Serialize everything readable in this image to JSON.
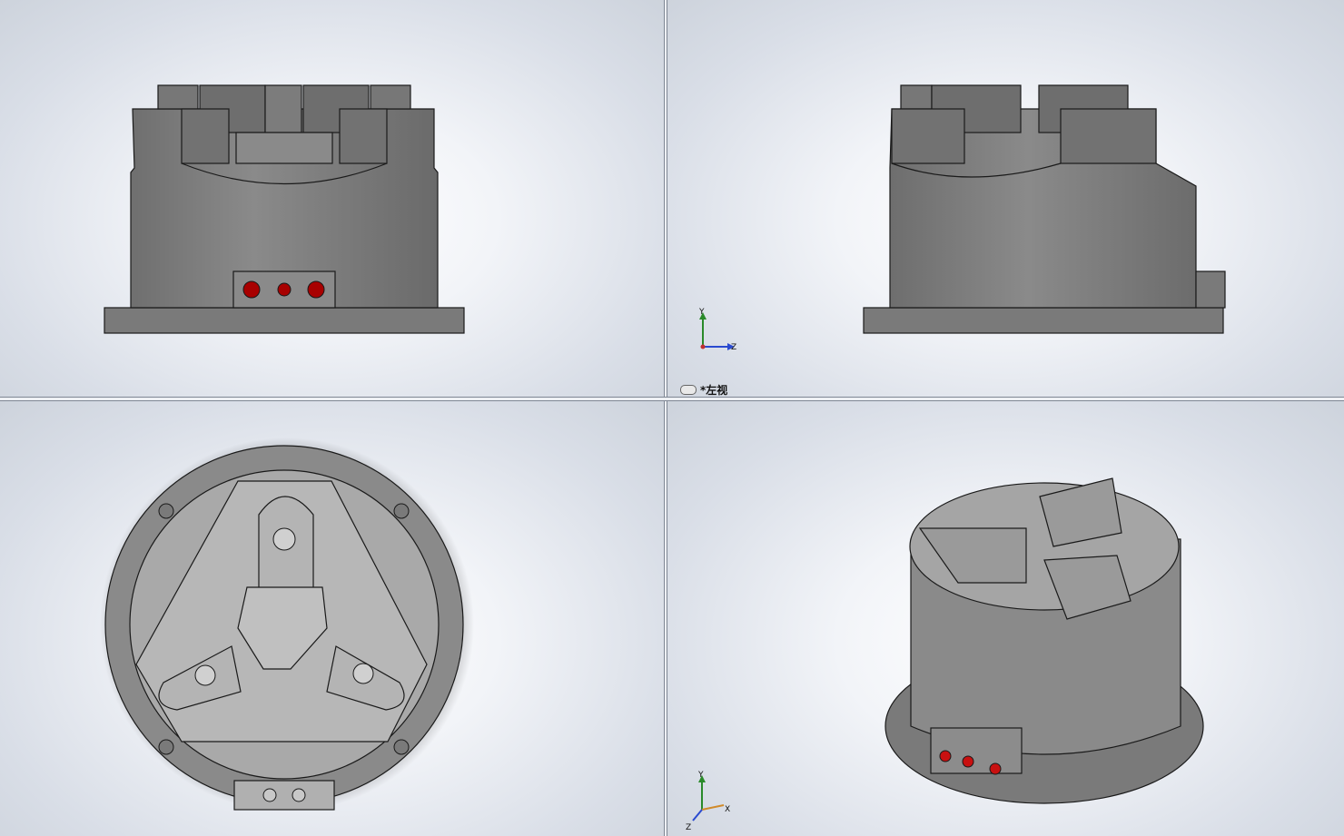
{
  "viewports": {
    "front": {
      "name": "front-view"
    },
    "left": {
      "name": "left-view",
      "label": "*左视"
    },
    "top": {
      "name": "top-view"
    },
    "iso": {
      "name": "isometric-view"
    }
  },
  "triad_left": {
    "y": "Y",
    "z": "Z"
  },
  "triad_iso": {
    "y": "Y",
    "x": "X",
    "z": "Z"
  },
  "colors": {
    "body": "#808080",
    "edge": "#1a1a1a",
    "port": "#a80000",
    "bg": "#eef1f6"
  },
  "icons": {
    "view_link": "link-icon"
  }
}
